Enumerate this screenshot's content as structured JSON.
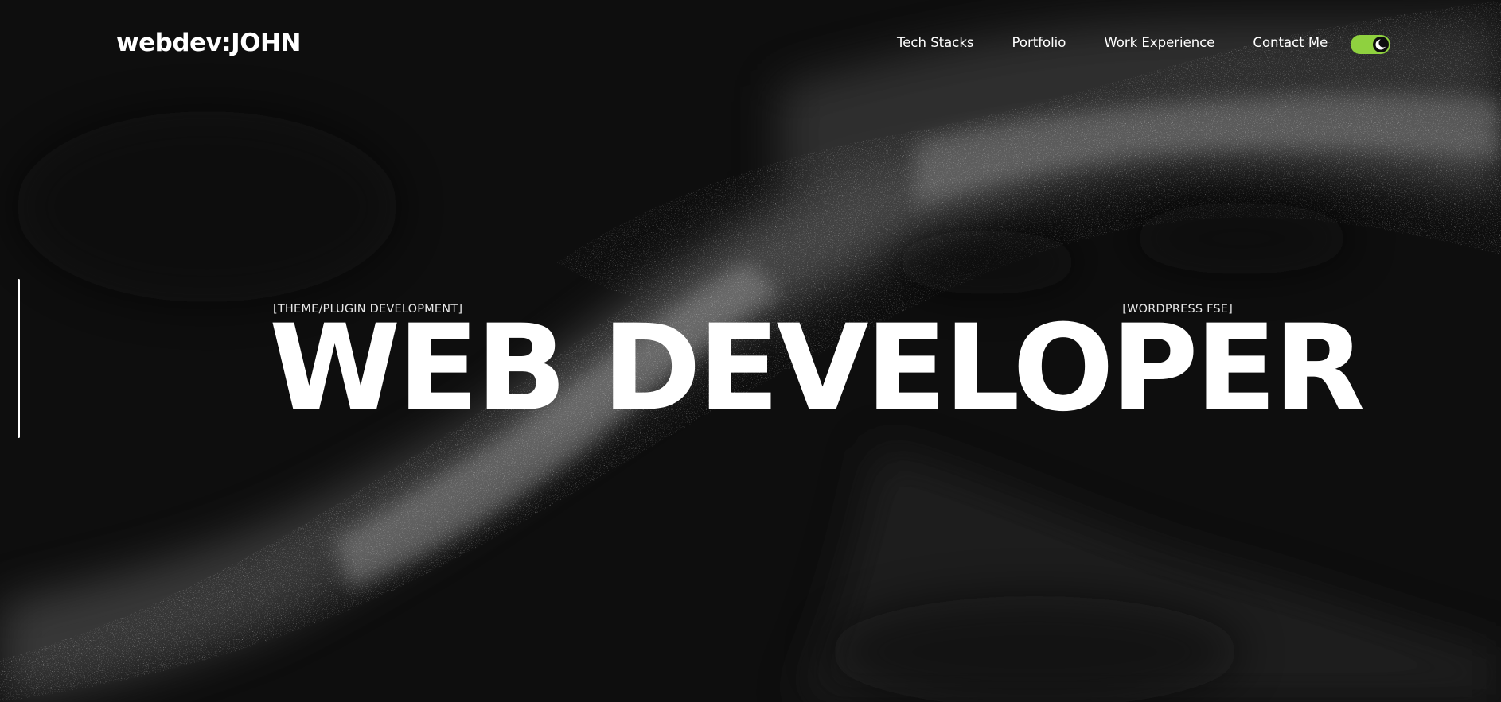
{
  "header": {
    "logo": "webdev:JOHN",
    "nav": [
      {
        "label": "Tech Stacks"
      },
      {
        "label": "Portfolio"
      },
      {
        "label": "Work Experience"
      },
      {
        "label": "Contact Me"
      }
    ],
    "theme_toggle": {
      "state": "dark",
      "accent": "#8fd13f"
    }
  },
  "hero": {
    "tag_left": "[THEME/PLUGIN DEVELOPMENT]",
    "tag_right": "[WORDPRESS FSE]",
    "title": "WEB DEVELOPER"
  },
  "colors": {
    "background": "#0e0e0e",
    "text": "#ffffff",
    "accent": "#8fd13f"
  },
  "icons": {
    "toggle_icon": "moon-icon"
  }
}
